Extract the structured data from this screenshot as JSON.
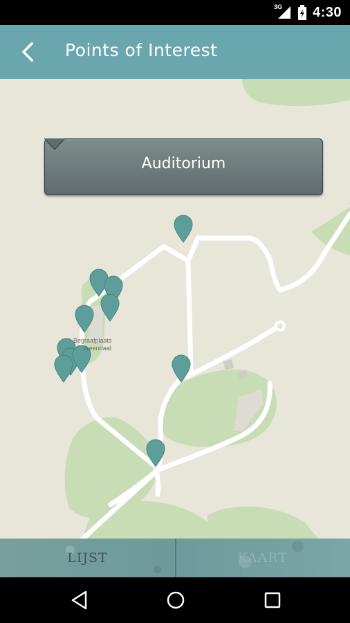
{
  "status_bar": {
    "network_label": "3G",
    "time": "4:30"
  },
  "app_bar": {
    "title": "Points of Interest"
  },
  "map": {
    "tooltip_title": "Auditorium",
    "place_label_line1": "Begraafplaats",
    "place_label_line2": "Vreendaal",
    "marker_color": "#5e9e9a",
    "road_color": "#ffffff",
    "park_color": "#c8dcb6",
    "background_color": "#e8e6d8"
  },
  "tabs": {
    "list_label": "LIJST",
    "map_label": "KAART"
  },
  "nav": {
    "back_icon": "back-triangle-icon",
    "home_icon": "home-circle-icon",
    "recents_icon": "recents-square-icon"
  }
}
